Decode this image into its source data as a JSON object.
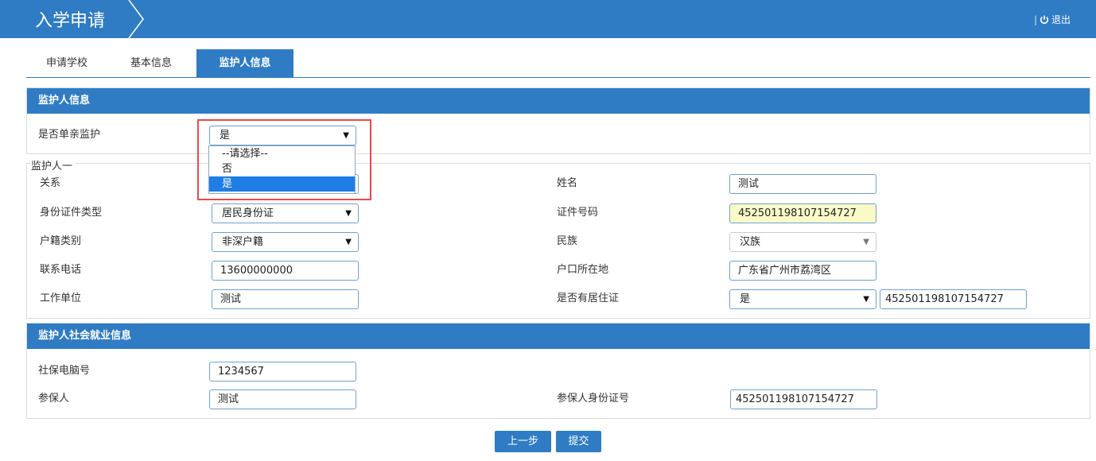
{
  "header": {
    "title": "入学申请",
    "logout_sep": "|",
    "logout_label": "退出"
  },
  "tabs": [
    {
      "label": "申请学校"
    },
    {
      "label": "基本信息"
    },
    {
      "label": "监护人信息"
    }
  ],
  "guardian_panel": {
    "title": "监护人信息",
    "single_parent_label": "是否单亲监护",
    "single_parent_value": "是",
    "dropdown_options": [
      "--请选择--",
      "否",
      "是"
    ]
  },
  "guardian_one": {
    "legend": "监护人一",
    "relation_label": "关系",
    "name_label": "姓名",
    "name_value": "测试",
    "id_type_label": "身份证件类型",
    "id_type_value": "居民身份证",
    "id_number_label": "证件号码",
    "id_number_value": "452501198107154727",
    "hukou_label": "户籍类别",
    "hukou_value": "非深户籍",
    "ethnicity_label": "民族",
    "ethnicity_value": "汉族",
    "phone_label": "联系电话",
    "phone_value": "13600000000",
    "hukou_location_label": "户口所在地",
    "hukou_location_value": "广东省广州市荔湾区",
    "work_label": "工作单位",
    "work_value": "测试",
    "residence_label": "是否有居住证",
    "residence_value": "是",
    "residence_number_value": "452501198107154727"
  },
  "social_panel": {
    "title": "监护人社会就业信息",
    "social_no_label": "社保电脑号",
    "social_no_value": "1234567",
    "insured_label": "参保人",
    "insured_value": "测试",
    "insured_id_label": "参保人身份证号",
    "insured_id_value": "452501198107154727"
  },
  "buttons": {
    "prev": "上一步",
    "submit": "提交"
  },
  "colors": {
    "primary": "#2f7cc4",
    "highlight": "#e84a4a",
    "selected": "#1e7ee5"
  }
}
